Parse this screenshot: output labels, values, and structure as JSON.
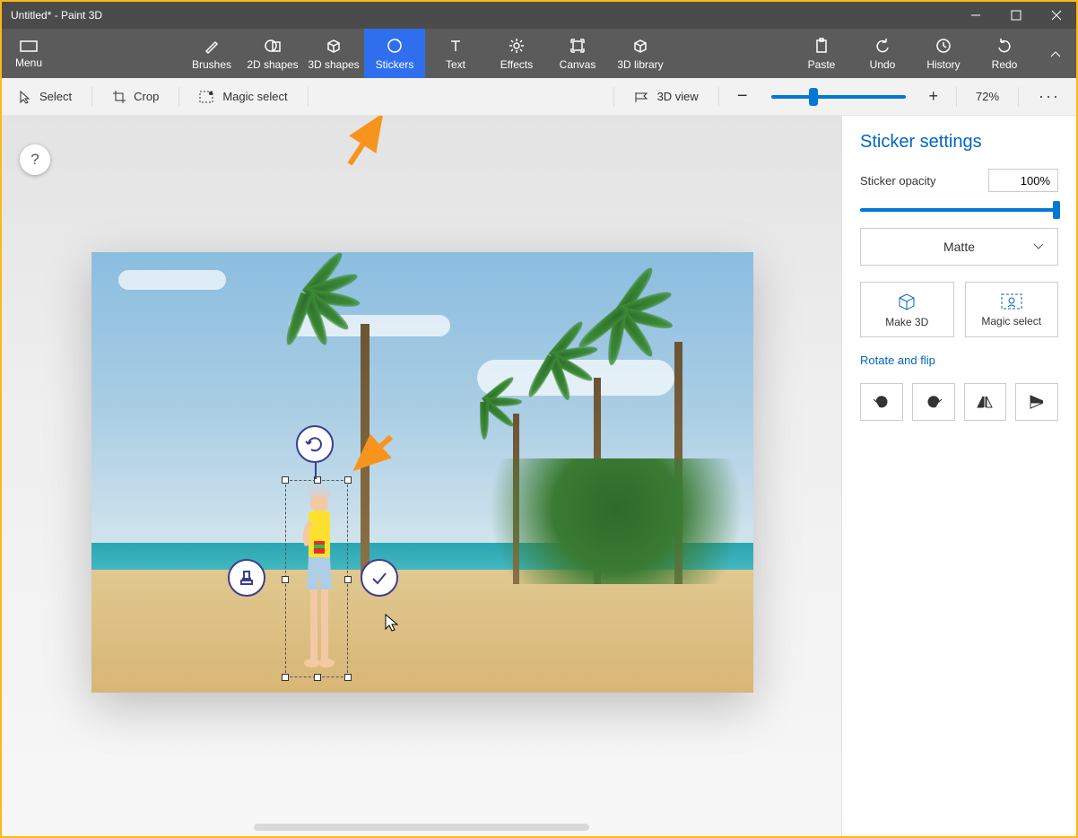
{
  "window": {
    "title": "Untitled* - Paint 3D"
  },
  "ribbon": {
    "menu": "Menu",
    "items": [
      {
        "label": "Brushes"
      },
      {
        "label": "2D shapes"
      },
      {
        "label": "3D shapes"
      },
      {
        "label": "Stickers"
      },
      {
        "label": "Text"
      },
      {
        "label": "Effects"
      },
      {
        "label": "Canvas"
      },
      {
        "label": "3D library"
      }
    ],
    "paste": "Paste",
    "undo": "Undo",
    "history": "History",
    "redo": "Redo"
  },
  "toolbar": {
    "select": "Select",
    "crop": "Crop",
    "magic_select": "Magic select",
    "view3d": "3D view",
    "zoom_percent": "72%"
  },
  "help": {
    "label": "?"
  },
  "side": {
    "title": "Sticker settings",
    "opacity_label": "Sticker opacity",
    "opacity_value": "100%",
    "material": "Matte",
    "make3d": "Make 3D",
    "magic_select": "Magic select",
    "rotate_flip": "Rotate and flip"
  }
}
